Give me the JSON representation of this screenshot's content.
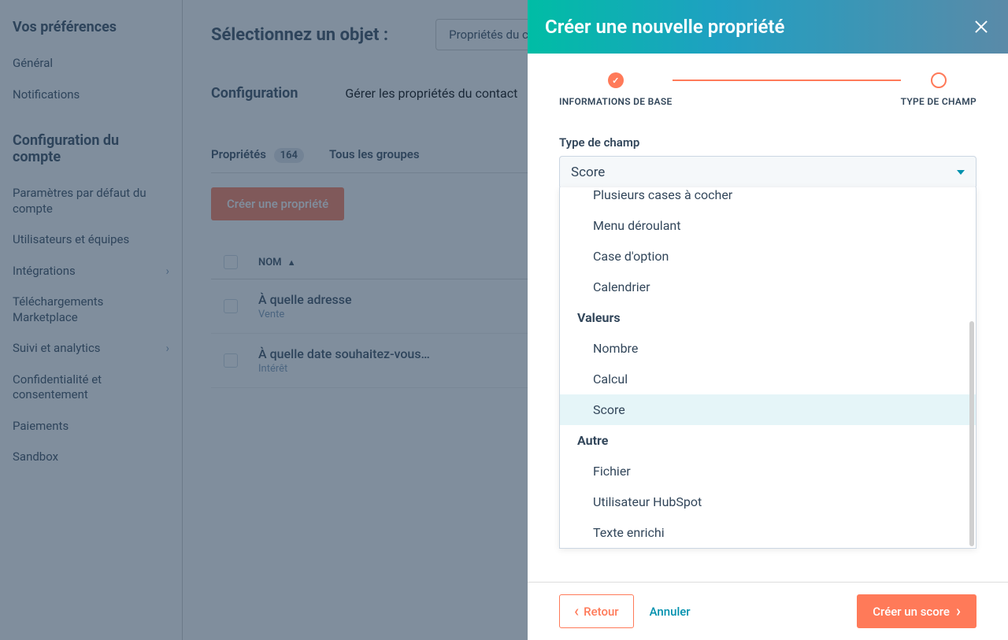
{
  "sidebar": {
    "section1_title": "Vos préférences",
    "items1": [
      {
        "label": "Général"
      },
      {
        "label": "Notifications"
      }
    ],
    "section2_title": "Configuration du compte",
    "items2": [
      {
        "label": "Paramètres par défaut du compte"
      },
      {
        "label": "Utilisateurs et équipes"
      },
      {
        "label": "Intégrations",
        "has_children": true
      },
      {
        "label": "Téléchargements Marketplace"
      },
      {
        "label": "Suivi et analytics",
        "has_children": true
      },
      {
        "label": "Confidentialité et consentement"
      },
      {
        "label": "Paiements"
      },
      {
        "label": "Sandbox"
      }
    ]
  },
  "content": {
    "page_title": "Sélectionnez un objet :",
    "object_select": "Propriétés du contact",
    "group_label": "Configuration",
    "group_text": "Gérer les propriétés du contact",
    "tabs": {
      "props": {
        "label": "Propriétés",
        "count": "164"
      },
      "groups": {
        "label": "Tous les groupes"
      }
    },
    "create_button": "Créer une propriété",
    "table": {
      "name_header": "Nom",
      "sort": "▲",
      "rows": [
        {
          "title": "À quelle adresse",
          "sub": "Vente"
        },
        {
          "title": "À quelle date souhaitez-vous…",
          "sub": "Intérêt"
        }
      ]
    }
  },
  "panel": {
    "title": "Créer une nouvelle propriété",
    "step1": "INFORMATIONS DE BASE",
    "step2": "TYPE DE CHAMP",
    "field_label": "Type de champ",
    "selected_value": "Score",
    "dropdown": {
      "cut_option": "Plusieurs cases à cocher",
      "group_top_options": [
        "Menu déroulant",
        "Case d'option",
        "Calendrier"
      ],
      "group_values": {
        "label": "Valeurs",
        "options": [
          "Nombre",
          "Calcul",
          "Score"
        ]
      },
      "group_other": {
        "label": "Autre",
        "options": [
          "Fichier",
          "Utilisateur HubSpot",
          "Texte enrichi"
        ]
      }
    },
    "footer": {
      "back": "Retour",
      "cancel": "Annuler",
      "create": "Créer un score"
    }
  }
}
